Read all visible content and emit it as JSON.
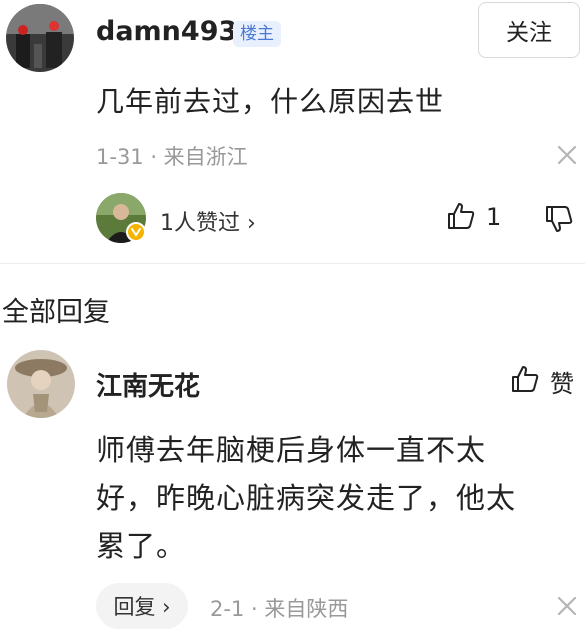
{
  "post": {
    "username": "damn493",
    "owner_badge": "楼主",
    "follow_label": "关注",
    "content": "几年前去过，什么原因去世",
    "meta": "1-31 · 来自浙江",
    "likers_text": "1人赞过 ›",
    "like_count": "1"
  },
  "section_title": "全部回复",
  "reply": {
    "username": "江南无花",
    "like_label": "赞",
    "content_lines": [
      "师傅去年脑梗后身体一直不太",
      "好，昨晚心脏病突发走了，他太",
      "累了。"
    ],
    "reply_button": "回复 ›",
    "meta": "2-1 · 来自陕西"
  },
  "icons": {
    "close": "close-icon",
    "thumbs_up": "thumbs-up-icon",
    "thumbs_down": "thumbs-down-icon",
    "verified": "verified-badge-icon"
  },
  "colors": {
    "badge_bg": "#e9f0fd",
    "badge_text": "#4a78d6",
    "verified": "#f5b400"
  }
}
